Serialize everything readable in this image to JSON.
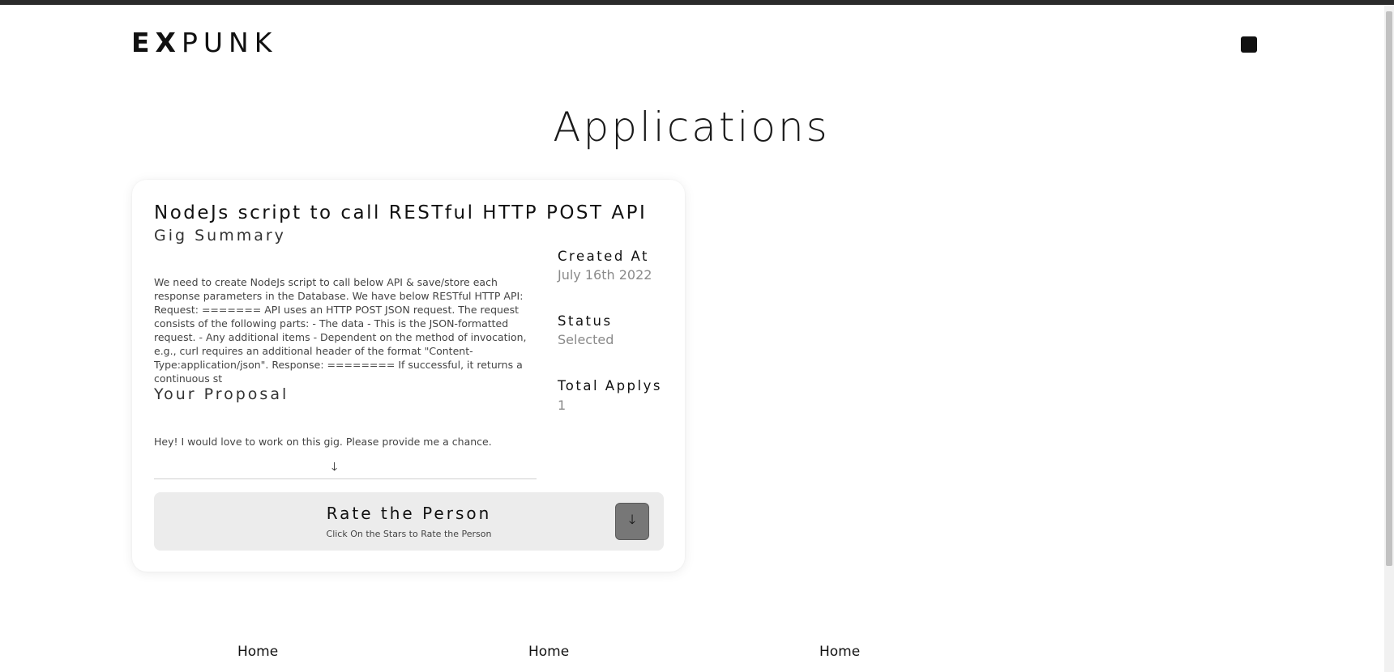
{
  "brand": {
    "logo_bold": "EX",
    "logo_light": "PUNK"
  },
  "header": {
    "menu_icon": "menu-square-icon"
  },
  "page": {
    "title": "Applications"
  },
  "card": {
    "title": "NodeJs script to call RESTful HTTP POST API",
    "summary_heading": "Gig Summary",
    "summary_text": "We need to create NodeJs script to call below API & save/store each response parameters in the Database. We have below RESTful HTTP API: Request: ======= API uses an HTTP POST JSON request. The request consists of the following parts: - The data - This is the JSON-formatted request. - Any additional items - Dependent on the method of invocation, e.g., curl requires an additional header of the format \"Content-Type:application/json\". Response: ======== If successful, it returns a continuous st",
    "proposal_heading": "Your Proposal",
    "proposal_text": "Hey! I would love to work on this gig. Please provide me a chance.",
    "expand_icon": "arrow-down-icon",
    "created_label": "Created At",
    "created_value": "July 16th 2022",
    "status_label": "Status",
    "status_value": "Selected",
    "applys_label": "Total Applys",
    "applys_value": "1",
    "rate": {
      "title": "Rate the Person",
      "subtitle": "Click On the Stars to Rate the Person",
      "toggle_icon": "arrow-down-icon"
    }
  },
  "footer": {
    "columns": [
      "Home",
      "Home",
      "Home"
    ]
  }
}
